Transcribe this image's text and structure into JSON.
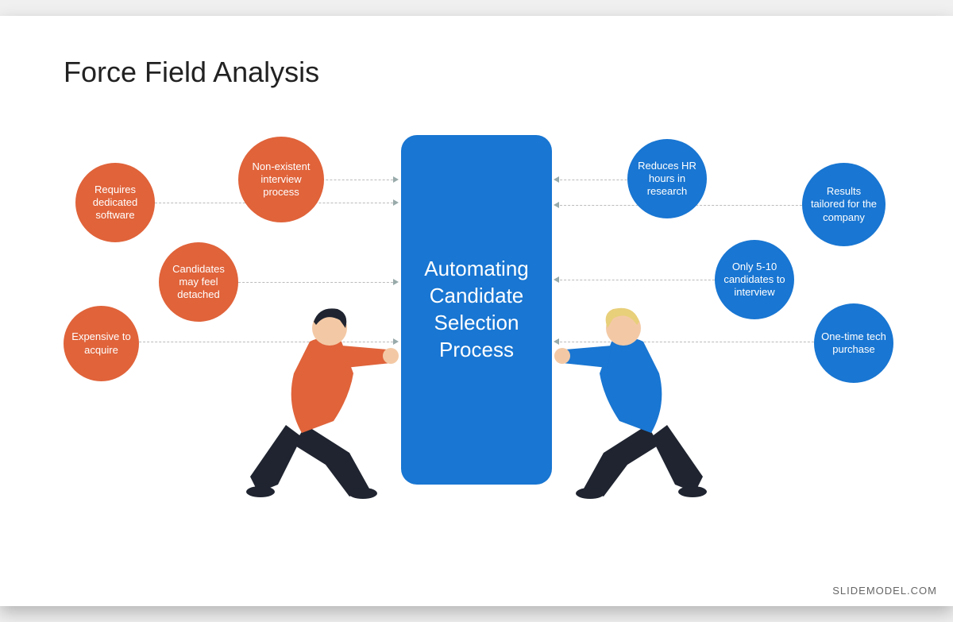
{
  "title": "Force Field Analysis",
  "center": "Automating Candidate Selection Process",
  "restraining": [
    "Requires dedicated software",
    "Non-existent interview process",
    "Candidates may feel detached",
    "Expensive to acquire"
  ],
  "driving": [
    "Reduces HR hours in research",
    "Results tailored for the company",
    "Only 5-10 candidates to interview",
    "One-time tech purchase"
  ],
  "watermark": "SLIDEMODEL.COM",
  "colors": {
    "restraining": "#e0633a",
    "driving": "#1976d2"
  }
}
